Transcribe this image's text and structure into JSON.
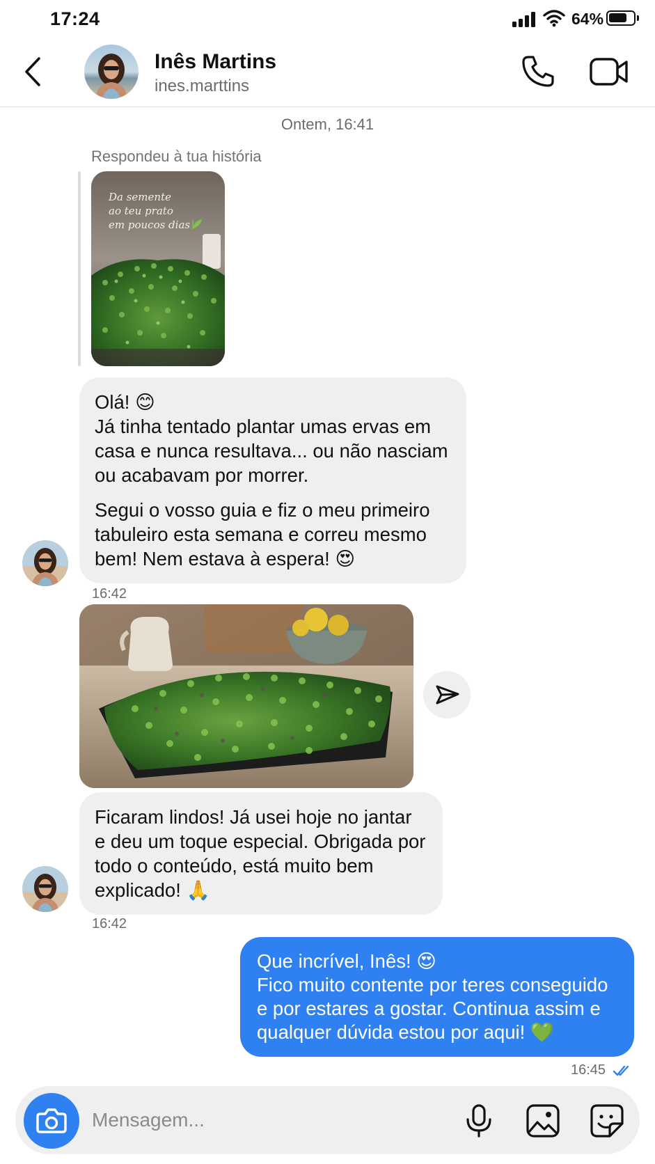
{
  "status_bar": {
    "time": "17:24",
    "battery": "64%"
  },
  "header": {
    "name": "Inês Martins",
    "username": "ines.marttins"
  },
  "conversation": {
    "date_separator": "Ontem, 16:41",
    "reply_label": "Respondeu à tua história",
    "story_caption": [
      "Da semente",
      "ao teu prato",
      "em poucos dias"
    ],
    "msg1": {
      "line1": "Olá! 😊",
      "para1": "Já tinha tentado plantar umas ervas em casa e nunca resultava... ou não nasciam ou acabavam por morrer.",
      "para2": "Segui o vosso guia e fiz o meu primeiro tabuleiro esta semana e correu mesmo bem! Nem estava à espera! 😍",
      "time": "16:42"
    },
    "msg2": {
      "text": "Ficaram lindos! Já usei hoje no jantar e deu um toque especial. Obrigada por todo o conteúdo, está muito bem explicado! 🙏",
      "time": "16:42"
    },
    "msg3": {
      "line1": "Que incrível, Inês! 😍",
      "line2": "Fico muito contente por teres conseguido e por estares a gostar. Continua assim e qualquer dúvida estou por aqui! 💚",
      "time": "16:45"
    }
  },
  "composer": {
    "placeholder": "Mensagem..."
  },
  "colors": {
    "accent": "#2f80f0",
    "bubble_in": "#efefef"
  }
}
